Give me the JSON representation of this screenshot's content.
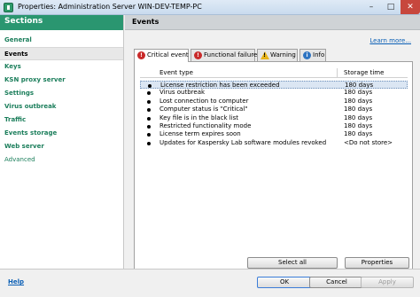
{
  "window": {
    "title": "Properties: Administration Server WIN-DEV-TEMP-PC"
  },
  "sidebar": {
    "header": "Sections",
    "items": [
      {
        "label": "General",
        "active": false
      },
      {
        "label": "Events",
        "active": true
      },
      {
        "label": "Keys",
        "active": false
      },
      {
        "label": "KSN proxy server",
        "active": false
      },
      {
        "label": "Settings",
        "active": false
      },
      {
        "label": "Virus outbreak",
        "active": false
      },
      {
        "label": "Traffic",
        "active": false
      },
      {
        "label": "Events storage",
        "active": false
      },
      {
        "label": "Web server",
        "active": false
      },
      {
        "label": "Advanced",
        "active": false
      }
    ]
  },
  "main": {
    "header": "Events",
    "learn_more": "Learn more...",
    "tabs": [
      {
        "label": "Critical event",
        "icon": "critical-icon",
        "active": true
      },
      {
        "label": "Functional failure",
        "icon": "error-icon",
        "active": false
      },
      {
        "label": "Warning",
        "icon": "warning-icon",
        "active": false
      },
      {
        "label": "Info",
        "icon": "info-icon",
        "active": false
      }
    ],
    "table": {
      "columns": [
        "Event type",
        "Storage time"
      ],
      "rows": [
        {
          "event": "License restriction has been exceeded",
          "storage": "180 days",
          "selected": true
        },
        {
          "event": "Virus outbreak",
          "storage": "180 days",
          "selected": false
        },
        {
          "event": "Lost connection to computer",
          "storage": "180 days",
          "selected": false
        },
        {
          "event": "Computer status is \"Critical\"",
          "storage": "180 days",
          "selected": false
        },
        {
          "event": "Key file is in the black list",
          "storage": "180 days",
          "selected": false
        },
        {
          "event": "Restricted functionality mode",
          "storage": "180 days",
          "selected": false
        },
        {
          "event": "License term expires soon",
          "storage": "180 days",
          "selected": false
        },
        {
          "event": "Updates for Kaspersky Lab software modules revoked",
          "storage": "<Do not store>",
          "selected": false
        }
      ]
    },
    "buttons": {
      "select_all": "Select all",
      "properties": "Properties"
    }
  },
  "footer": {
    "help": "Help",
    "ok": "OK",
    "cancel": "Cancel",
    "apply": "Apply"
  },
  "colors": {
    "accent_green": "#2a9670",
    "link_blue": "#0b5fb5",
    "critical_red": "#c92a2a"
  }
}
